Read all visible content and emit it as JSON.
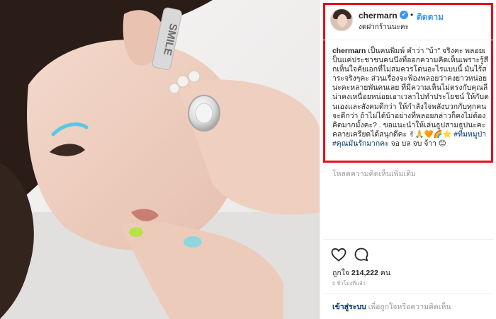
{
  "post": {
    "username": "chermarn",
    "verified_icon": "verified-badge-icon",
    "dot": "•",
    "follow_label": "ติดตาม",
    "location": "งดฝากร้านนะคะ",
    "caption_user": "chermarn",
    "caption_text": " เป็นคนพิมพ์ คำว่า \"บ้า\" จริงคะ พลอยเป็นแค่ประชาชนคนนึงที่ออกความคิดเห็นเพราะรู้สึกเห็นใจคัยเอกที่ไม่สมควรโดนอะไรแบบนี้ มันไร้สาระจริงๆคะ ส่วนเรื่องจะฟ้องพลอยว่าคงยาวหน่อยนะคะหลายพันคนเลย ที่มีความเห็นไม่ตรงกับคุณลีน่าคงเหนื่อยหน่อยเอาเวลาไปทำประโยชน์ ให้กับตนเองและสังคมดีกว่า ให้กำลังใจพลังบวกกับทุกคนจะดีกว่า ถ้าไม่ได้บ้าอย่างที่พลอยกล่าวก็คงไม่ต้องคิดมากมั้งคะ? . ขอแนะนำให้เล่นธูปสามธูปนะคะ คลายเครียดได้สนุกดีคะ ",
    "caption_emojis": "✌🙏🧡🌈⭐",
    "caption_hashtags": " #ทีมหมูป่า #คุณมันรักมากคะ",
    "caption_tail": " จอ บล จบ จ้าา 😊",
    "load_more_label": "โหลดความคิดเห็นเพิ่มเติม",
    "like_icon": "heart-icon",
    "comment_icon": "comment-bubble-icon",
    "likes_prefix": "ถูกใจ",
    "likes_count": "214,222",
    "likes_suffix": " คน",
    "timestamp": "5 ชั่วโมงที่แล้ว",
    "login_label": "เข้าสู่ระบบ",
    "login_suffix": " เพื่อถูกใจหรือความคิดเห็น"
  },
  "photo": {
    "earring_text": "SMILE"
  },
  "colors": {
    "highlight_box": "#e3101a",
    "link_blue": "#3897f0",
    "hashtag_navy": "#003569"
  }
}
